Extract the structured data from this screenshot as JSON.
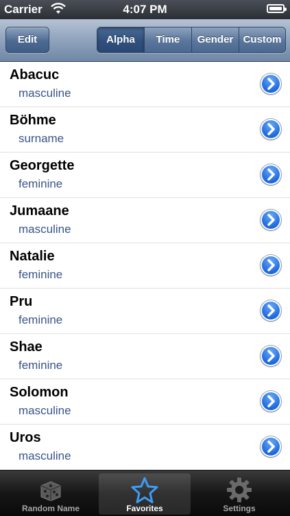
{
  "status_bar": {
    "carrier": "Carrier",
    "time": "4:07 PM"
  },
  "nav": {
    "edit_label": "Edit",
    "segments": [
      "Alpha",
      "Time",
      "Gender",
      "Custom"
    ],
    "selected_segment": "Alpha"
  },
  "names": [
    {
      "name": "Abacuc",
      "gender": "masculine"
    },
    {
      "name": "Böhme",
      "gender": "surname"
    },
    {
      "name": "Georgette",
      "gender": "feminine"
    },
    {
      "name": "Jumaane",
      "gender": "masculine"
    },
    {
      "name": "Natalie",
      "gender": "feminine"
    },
    {
      "name": "Pru",
      "gender": "feminine"
    },
    {
      "name": "Shae",
      "gender": "feminine"
    },
    {
      "name": "Solomon",
      "gender": "masculine"
    },
    {
      "name": "Uros",
      "gender": "masculine"
    }
  ],
  "tabs": [
    {
      "label": "Random Name",
      "icon": "dice-icon",
      "active": false
    },
    {
      "label": "Favorites",
      "icon": "star-icon",
      "active": true
    },
    {
      "label": "Settings",
      "icon": "gear-icon",
      "active": false
    }
  ],
  "colors": {
    "accent": "#1f6ce0",
    "subtitle": "#385487",
    "nav": "#6f87a6"
  }
}
